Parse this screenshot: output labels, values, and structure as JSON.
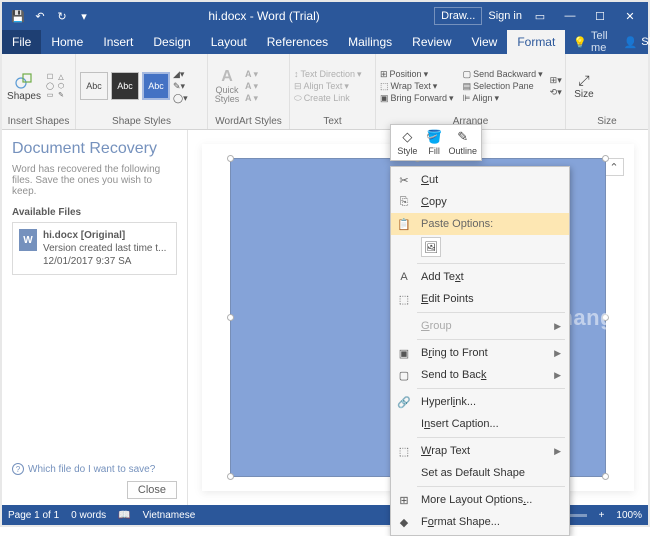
{
  "title": "hi.docx - Word (Trial)",
  "titlebar": {
    "draw_btn": "Draw...",
    "signin": "Sign in"
  },
  "tabs": {
    "file": "File",
    "home": "Home",
    "insert": "Insert",
    "design": "Design",
    "layout": "Layout",
    "references": "References",
    "mailings": "Mailings",
    "review": "Review",
    "view": "View",
    "format": "Format",
    "tellme": "Tell me",
    "share": "Share"
  },
  "ribbon": {
    "shapes_label": "Shapes",
    "insert_shapes": "Insert Shapes",
    "abc": "Abc",
    "shape_styles": "Shape Styles",
    "quick_styles": "Quick Styles",
    "wordart_styles": "WordArt Styles",
    "text_direction": "Text Direction",
    "align_text": "Align Text",
    "create_link": "Create Link",
    "text": "Text",
    "position": "Position",
    "wrap_text": "Wrap Text",
    "bring_forward": "Bring Forward",
    "send_backward": "Send Backward",
    "selection_pane": "Selection Pane",
    "align": "Align",
    "arrange": "Arrange",
    "size_label": "Size"
  },
  "recovery": {
    "title": "Document Recovery",
    "desc": "Word has recovered the following files. Save the ones you wish to keep.",
    "available": "Available Files",
    "file": {
      "name": "hi.docx  [Original]",
      "line2": "Version created last time t...",
      "line3": "12/01/2017 9:37 SA"
    },
    "ask": "Which file do I want to save?",
    "close": "Close"
  },
  "mini": {
    "style": "Style",
    "fill": "Fill",
    "outline": "Outline"
  },
  "ctx": {
    "cut": "Cut",
    "copy": "Copy",
    "paste_options": "Paste Options:",
    "add_text": "Add Text",
    "edit_points": "Edit Points",
    "group": "Group",
    "bring_front": "Bring to Front",
    "send_back": "Send to Back",
    "hyperlink": "Hyperlink...",
    "insert_caption": "Insert Caption...",
    "wrap_text": "Wrap Text",
    "set_default": "Set as Default Shape",
    "more_layout": "More Layout Options...",
    "format_shape": "Format Shape..."
  },
  "status": {
    "page": "Page 1 of 1",
    "words": "0 words",
    "lang": "Vietnamese",
    "zoom": "100%"
  },
  "watermark": "uantrimang"
}
